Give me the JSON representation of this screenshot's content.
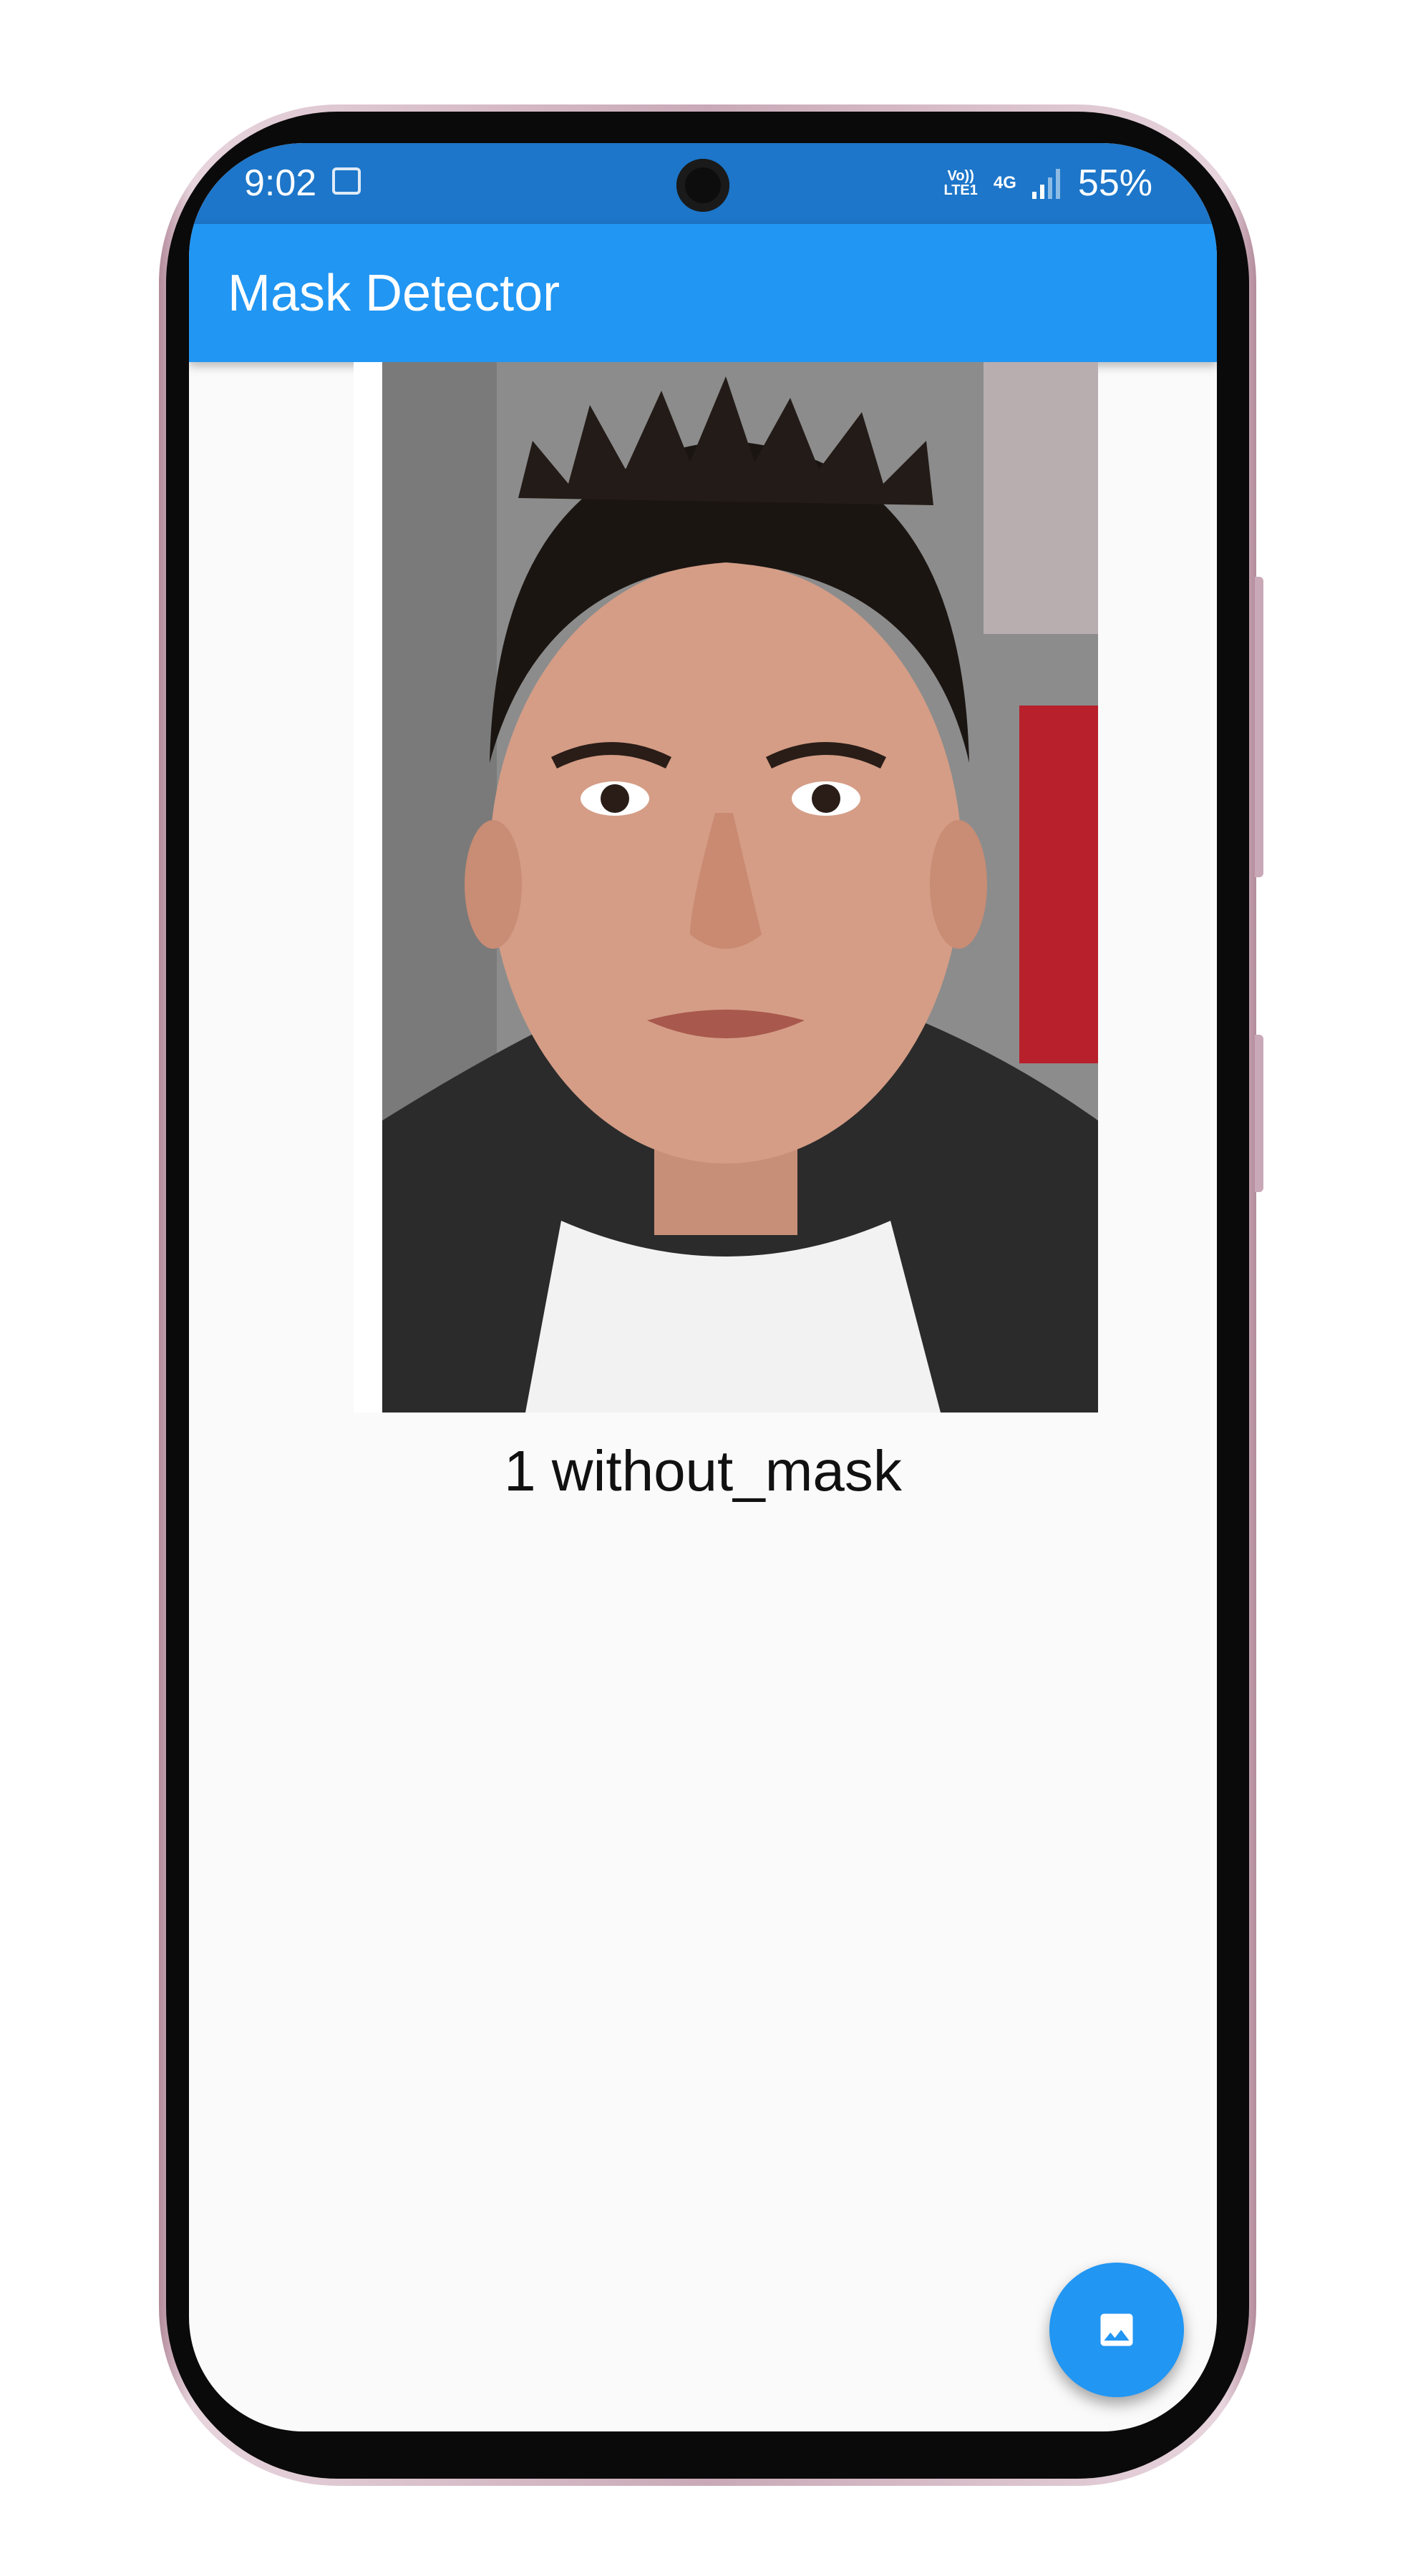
{
  "status_bar": {
    "time": "9:02",
    "volte_top": "Vo))",
    "volte_bottom": "LTE1",
    "network": "4G",
    "battery": "55%"
  },
  "app_bar": {
    "title": "Mask Detector"
  },
  "result": {
    "label": "1 without_mask"
  },
  "fab": {
    "icon": "image-icon"
  },
  "colors": {
    "primary": "#2196f3",
    "status_bar": "#1d76c9",
    "background": "#fafafa"
  }
}
